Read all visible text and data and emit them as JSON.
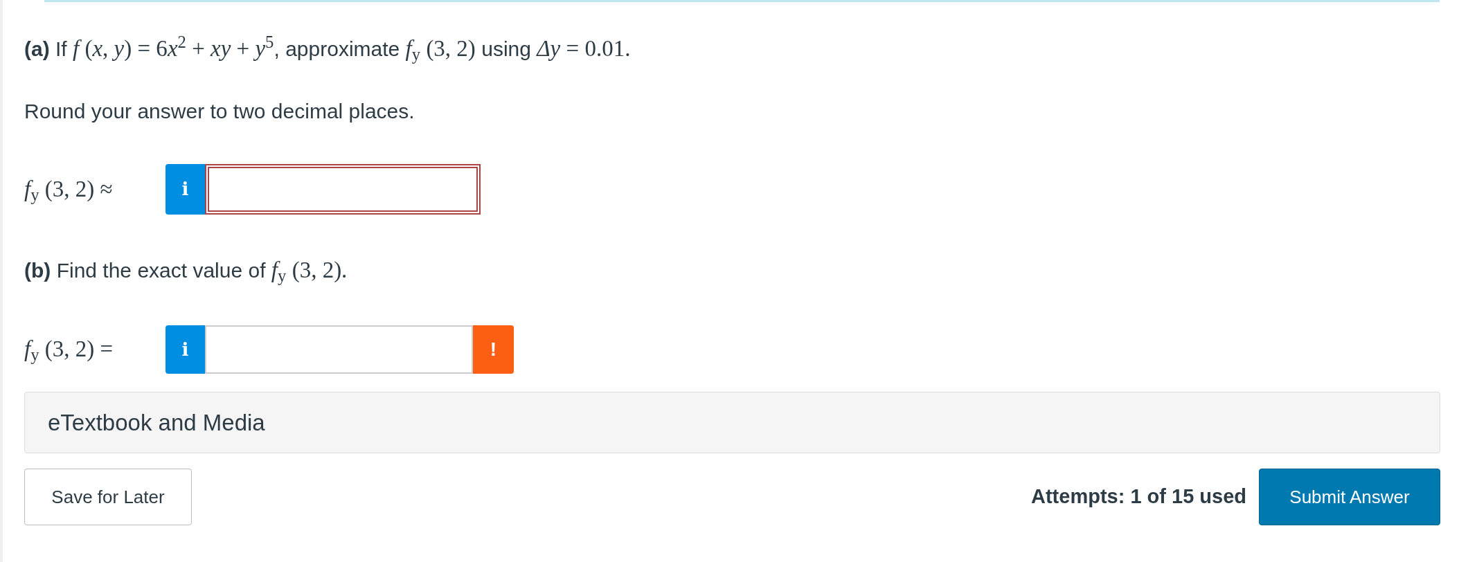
{
  "part_a": {
    "label": "(a)",
    "segments": [
      {
        "kind": "text",
        "text": "If "
      },
      {
        "kind": "math",
        "text": "*f* (*x*, *y*) = 6"
      },
      {
        "kind": "math",
        "text": "*x*$^{2}$ + *xy* + *y*$^{5}$"
      },
      {
        "kind": "text",
        "text": ", approximate "
      },
      {
        "kind": "math",
        "text": "*f*$_{y}$ (3, 2)"
      },
      {
        "kind": "text",
        "text": " using "
      },
      {
        "kind": "math",
        "text": "*Δy* = 0.01."
      }
    ]
  },
  "instruction": "Round your answer to two decimal places.",
  "answer_a": {
    "label": "*f*$_{y}$ (3, 2) ≈",
    "info": "i",
    "invalid": true
  },
  "part_b": {
    "label": "(b)",
    "segments": [
      {
        "kind": "text",
        "text": "Find the exact value of "
      },
      {
        "kind": "math",
        "text": "*f*$_{y}$ (3, 2)."
      }
    ]
  },
  "answer_b": {
    "label": "*f*$_{y}$ (3, 2) =",
    "info": "i",
    "invalid": false,
    "alert": "!"
  },
  "resources": "eTextbook and Media",
  "save_button": "Save for Later",
  "attempts": "Attempts: 1 of 15 used",
  "submit_button": "Submit Answer"
}
